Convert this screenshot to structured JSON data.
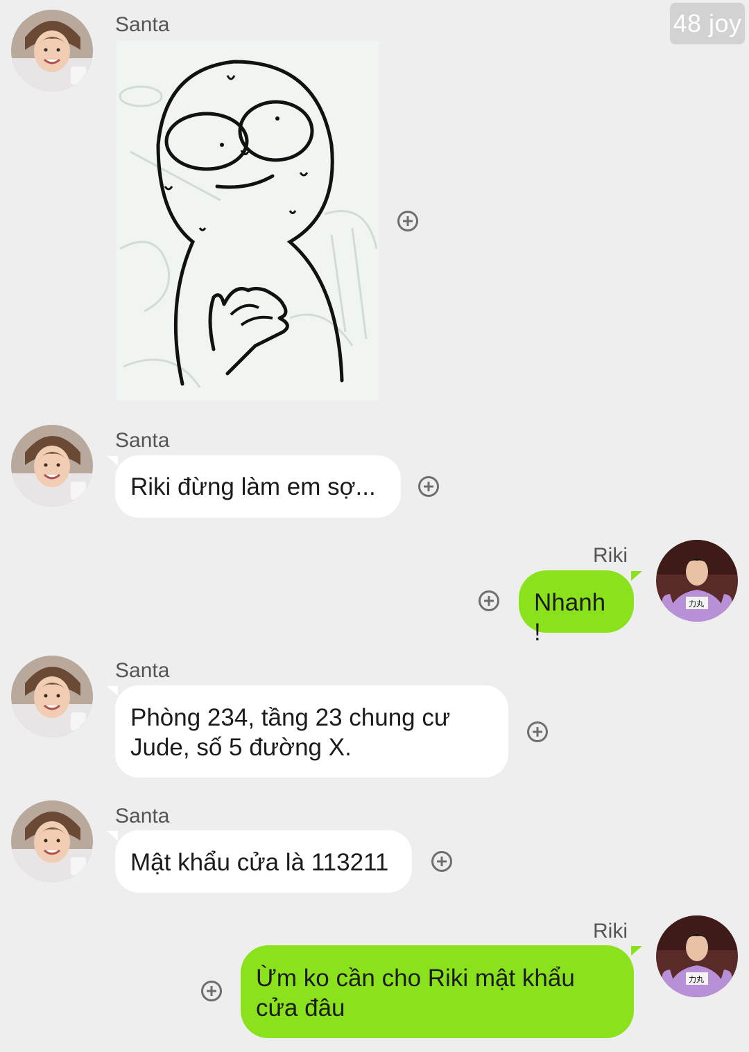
{
  "watermark": "48 joy",
  "colors": {
    "background": "#eeeeee",
    "incoming_bubble": "#ffffff",
    "outgoing_bubble": "#89e21b",
    "text": "#1b1b1b",
    "sender": "#555555"
  },
  "messages": [
    {
      "sender": "Santa",
      "type": "sticker",
      "sticker": "sweating-nervous-face-sticker"
    },
    {
      "sender": "Santa",
      "type": "text",
      "text": "Riki đừng làm em sợ..."
    },
    {
      "sender": "Riki",
      "type": "text",
      "text": "Nhanh !"
    },
    {
      "sender": "Santa",
      "type": "text",
      "lines": [
        "Phòng 234, tầng 23 chung cư",
        "Jude, số 5 đường X."
      ]
    },
    {
      "sender": "Santa",
      "type": "text",
      "text": "Mật khẩu cửa là 113211"
    },
    {
      "sender": "Riki",
      "type": "text",
      "lines": [
        "Ừm ko cần cho Riki mật khẩu",
        "cửa đâu"
      ]
    }
  ]
}
